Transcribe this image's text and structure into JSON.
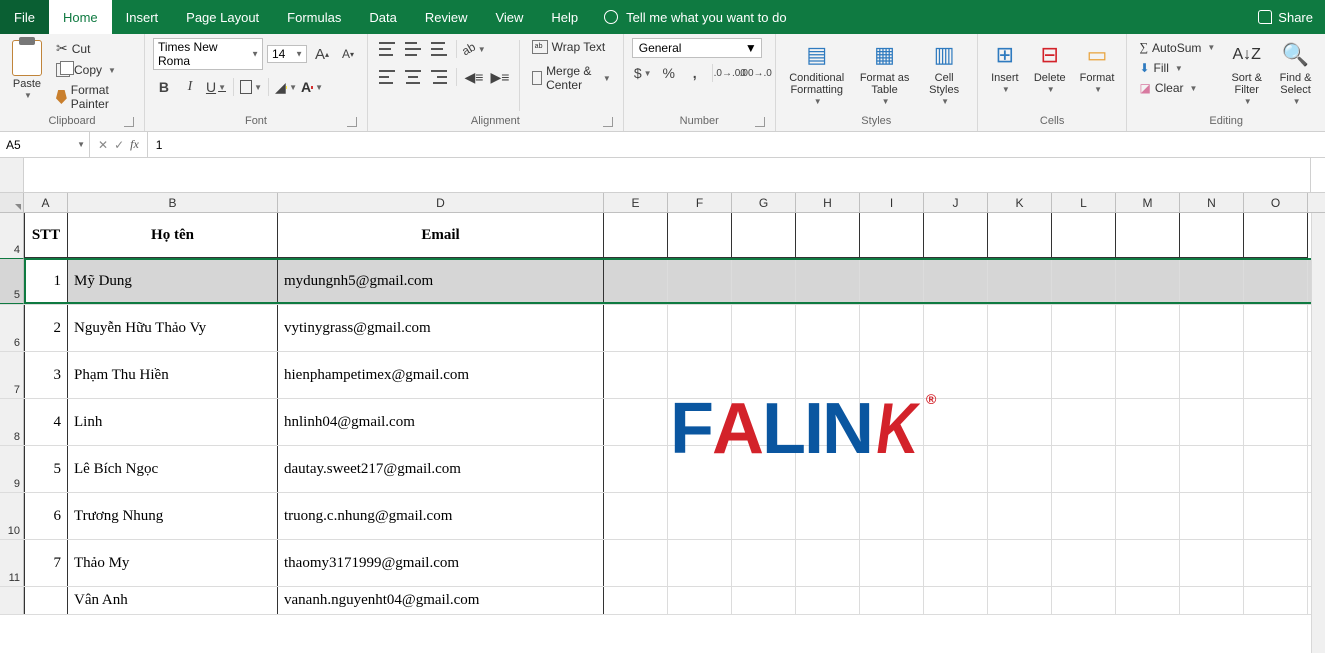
{
  "tabs": {
    "file": "File",
    "home": "Home",
    "insert": "Insert",
    "pageLayout": "Page Layout",
    "formulas": "Formulas",
    "data": "Data",
    "review": "Review",
    "view": "View",
    "help": "Help",
    "tell": "Tell me what you want to do",
    "share": "Share"
  },
  "ribbon": {
    "clipboard": {
      "label": "Clipboard",
      "paste": "Paste",
      "cut": "Cut",
      "copy": "Copy",
      "formatPainter": "Format Painter"
    },
    "font": {
      "label": "Font",
      "name": "Times New Roma",
      "size": "14",
      "increase": "A",
      "decrease": "A"
    },
    "alignment": {
      "label": "Alignment",
      "wrap": "Wrap Text",
      "merge": "Merge & Center"
    },
    "number": {
      "label": "Number",
      "format": "General"
    },
    "styles": {
      "label": "Styles",
      "cond": "Conditional Formatting",
      "table": "Format as Table",
      "cell": "Cell Styles"
    },
    "cells": {
      "label": "Cells",
      "insert": "Insert",
      "delete": "Delete",
      "format": "Format"
    },
    "editing": {
      "label": "Editing",
      "autosum": "AutoSum",
      "fill": "Fill",
      "clear": "Clear",
      "sort": "Sort & Filter",
      "find": "Find & Select"
    }
  },
  "formulaBar": {
    "nameBox": "A5",
    "value": "1"
  },
  "columns": [
    "A",
    "B",
    "D",
    "E",
    "F",
    "G",
    "H",
    "I",
    "J",
    "K",
    "L",
    "M",
    "N",
    "O"
  ],
  "rowHeaders": [
    "4",
    "5",
    "6",
    "7",
    "8",
    "9",
    "10",
    "11",
    ""
  ],
  "table": {
    "headers": {
      "stt": "STT",
      "name": "Họ tên",
      "email": "Email"
    },
    "rows": [
      {
        "stt": "1",
        "name": "Mỹ Dung",
        "email": "mydungnh5@gmail.com"
      },
      {
        "stt": "2",
        "name": "Nguyễn Hữu Thảo Vy",
        "email": "vytinygrass@gmail.com"
      },
      {
        "stt": "3",
        "name": "Phạm Thu Hiền",
        "email": "hienphampetimex@gmail.com"
      },
      {
        "stt": "4",
        "name": "Linh",
        "email": "hnlinh04@gmail.com"
      },
      {
        "stt": "5",
        "name": "Lê Bích Ngọc",
        "email": "dautay.sweet217@gmail.com"
      },
      {
        "stt": "6",
        "name": "Trương Nhung",
        "email": "truong.c.nhung@gmail.com"
      },
      {
        "stt": "7",
        "name": "Thảo My",
        "email": "thaomy3171999@gmail.com"
      },
      {
        "stt": "",
        "name": "Vân Anh",
        "email": "vananh.nguyenht04@gmail.com"
      }
    ]
  },
  "watermark": {
    "text": "FALINK",
    "reg": "®"
  }
}
